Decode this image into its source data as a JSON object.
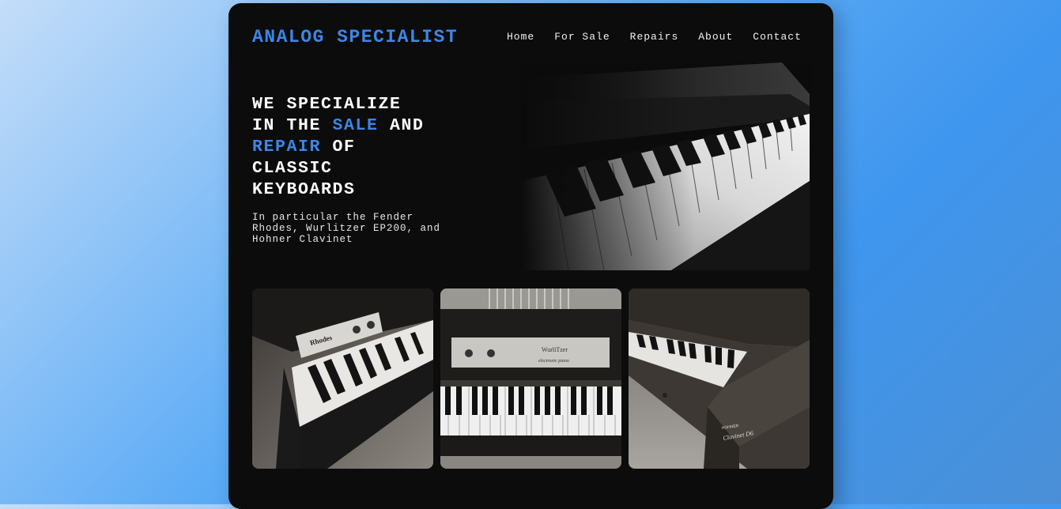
{
  "brand": {
    "name": "ANALOG SPECIALIST"
  },
  "nav": {
    "items": [
      {
        "label": "Home"
      },
      {
        "label": "For Sale"
      },
      {
        "label": "Repairs"
      },
      {
        "label": "About"
      },
      {
        "label": "Contact"
      }
    ]
  },
  "hero": {
    "headline": {
      "line1": "WE SPECIALIZE",
      "line2_a": "IN THE ",
      "line2_hl": "SALE",
      "line2_b": " AND",
      "line3_hl": "REPAIR",
      "line3_b": " OF",
      "line4": "CLASSIC",
      "line5": "KEYBOARDS"
    },
    "subtext": "In particular the Fender Rhodes, Wurlitzer EP200, and Hohner Clavinet"
  },
  "photos": {
    "rhodes_label": "Rhodes",
    "wurlitzer_label": "WurliTzer",
    "wurlitzer_sub": "electronic piano",
    "clavinet_label": "Clavinet D6",
    "hohner_label": "HOHNER"
  },
  "colors": {
    "accent": "#3d86e6",
    "card_bg": "#0c0c0d",
    "text": "#ffffff"
  }
}
